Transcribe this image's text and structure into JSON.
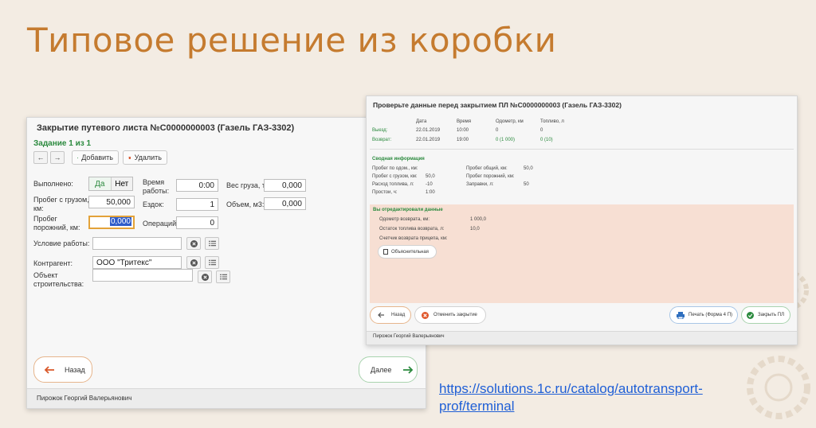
{
  "slide": {
    "title": "Типовое решение из коробки",
    "link_line1": "https://solutions.1c.ru/catalog/autotransport-",
    "link_line2": "prof/terminal"
  },
  "left_window": {
    "title": "Закрытие путевого листа №С0000000003 (Газель ГАЗ-3302)",
    "task": "Задание 1 из 1",
    "nav_back": "←",
    "nav_forward": "→",
    "add_label": "Добавить",
    "delete_label": "Удалить",
    "done_label": "Выполнено:",
    "yes_label": "Да",
    "no_label": "Нет",
    "loaded_run_label": "Пробег с грузом, км:",
    "loaded_run_value": "50,000",
    "empty_run_label": "Пробег порожний, км:",
    "empty_run_value": "0,000",
    "work_time_label": "Время работы:",
    "work_time_value": "0:00",
    "trips_label": "Ездок:",
    "trips_value": "1",
    "operations_label": "Операций:",
    "operations_value": "0",
    "cargo_weight_label": "Вес груза, т:",
    "cargo_weight_value": "0,000",
    "volume_label": "Объем, м3:",
    "volume_value": "0,000",
    "work_condition_label": "Условие работы:",
    "work_condition_value": "",
    "counterparty_label": "Контрагент:",
    "counterparty_value": "ООО \"Тритекс\"",
    "construction_label": "Объект строительства:",
    "construction_value": "",
    "back_button": "Назад",
    "next_button": "Далее",
    "user": "Пирожок Георгий Валерьянович"
  },
  "right_window": {
    "title": "Проверьте данные перед закрытием ПЛ №С0000000003 (Газель ГАЗ-3302)",
    "table_headers": [
      "Дата",
      "Время",
      "Одометр, км",
      "Топливо, л"
    ],
    "departure_label": "Выезд:",
    "departure_row": [
      "22.01.2019",
      "10:00",
      "0",
      "0"
    ],
    "return_label": "Возврат:",
    "return_row": [
      "22.01.2019",
      "19:00",
      "0 (1 000)",
      "0 (10)"
    ],
    "summary_title": "Сводная информация",
    "summary_left": [
      {
        "label": "Пробег по одом., км:",
        "value": ""
      },
      {
        "label": "Пробег с грузом, км:",
        "value": "50,0"
      },
      {
        "label": "Расход топлива, л:",
        "value": "-10"
      },
      {
        "label": "Простои, ч:",
        "value": "1:00"
      }
    ],
    "summary_right": [
      {
        "label": "Пробег общий, км:",
        "value": "50,0"
      },
      {
        "label": "Пробег порожний, км:",
        "value": ""
      },
      {
        "label": "Заправки, л:",
        "value": "50"
      }
    ],
    "edited_title": "Вы отредактировали данные",
    "edited_rows": [
      {
        "label": "Одометр возврата, км:",
        "value": "1 000,0"
      },
      {
        "label": "Остаток топлива возврата, л:",
        "value": "10,0"
      },
      {
        "label": "Счетчик возврата прицепа, км:",
        "value": ""
      }
    ],
    "explanatory_button": "Объяснительная",
    "back_button": "Назад",
    "cancel_button": "Отменить закрытие",
    "print_button": "Печать (Форма 4 П)",
    "close_button": "Закрыть ПЛ",
    "user": "Пирожок Георгий Валерьянович"
  },
  "colors": {
    "title": "#c57b2f",
    "accent_green": "#2b8a3e",
    "edited_bg": "#f7dfd3",
    "link": "#1f5fd6"
  }
}
